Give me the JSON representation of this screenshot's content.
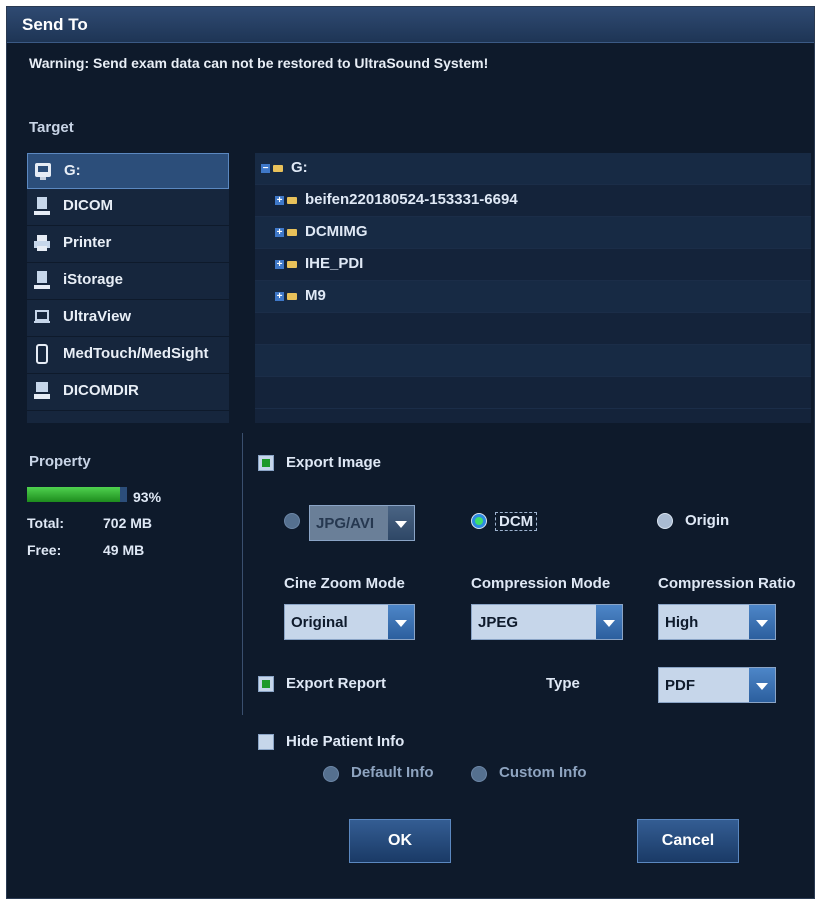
{
  "dialog": {
    "title": "Send To",
    "warning": "Warning: Send exam data can not be restored to UltraSound System!"
  },
  "target": {
    "label": "Target",
    "items": [
      {
        "label": "G:",
        "icon": "usb-drive-icon",
        "selected": true
      },
      {
        "label": "DICOM",
        "icon": "dicom-icon"
      },
      {
        "label": "Printer",
        "icon": "printer-icon"
      },
      {
        "label": "iStorage",
        "icon": "istorage-icon"
      },
      {
        "label": "UltraView",
        "icon": "laptop-icon"
      },
      {
        "label": "MedTouch/MedSight",
        "icon": "tablet-icon"
      },
      {
        "label": "DICOMDIR",
        "icon": "dicomdir-icon"
      }
    ]
  },
  "tree": {
    "root": "G:",
    "children": [
      "beifen220180524-153331-6694",
      "DCMIMG",
      "IHE_PDI",
      "M9"
    ]
  },
  "property": {
    "label": "Property",
    "percent_text": "93%",
    "used_fraction": 0.93,
    "total_label": "Total:",
    "total_value": "702 MB",
    "free_label": "Free:",
    "free_value": "49 MB"
  },
  "export_image": {
    "label": "Export Image",
    "checked": true,
    "format_options": [
      {
        "label": "JPG/AVI",
        "selected": false
      },
      {
        "label": "DCM",
        "selected": true
      },
      {
        "label": "Origin",
        "selected": false
      }
    ],
    "cine_zoom_mode": {
      "label": "Cine Zoom Mode",
      "value": "Original"
    },
    "compression_mode": {
      "label": "Compression Mode",
      "value": "JPEG"
    },
    "compression_ratio": {
      "label": "Compression Ratio",
      "value": "High"
    }
  },
  "export_report": {
    "label": "Export Report",
    "checked": true,
    "type_label": "Type",
    "type_value": "PDF"
  },
  "hide_patient_info": {
    "label": "Hide Patient Info",
    "checked": false,
    "options": [
      "Default Info",
      "Custom Info"
    ]
  },
  "buttons": {
    "ok": "OK",
    "cancel": "Cancel"
  },
  "colors": {
    "background": "#0e1a2b",
    "titlebar": "#1e3555",
    "accent": "#3f78c8",
    "progress": "#1d8c1d"
  }
}
